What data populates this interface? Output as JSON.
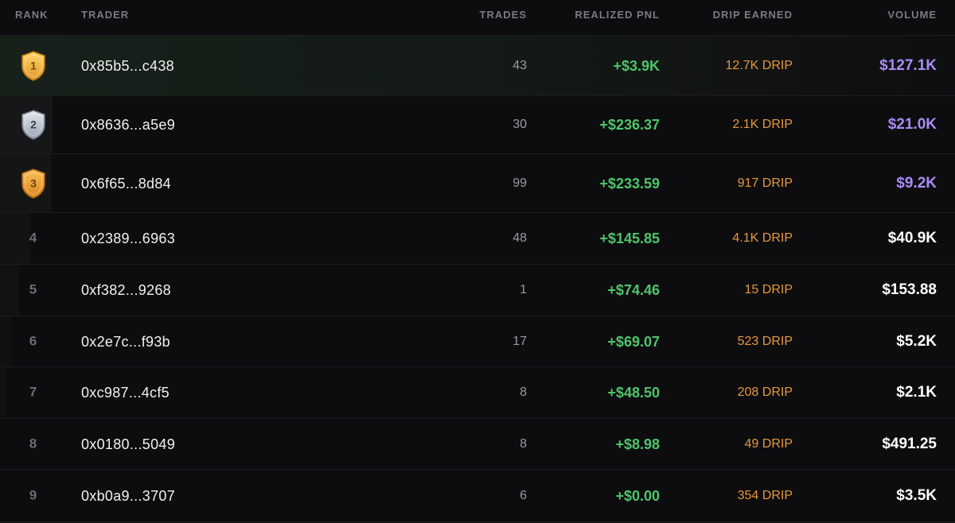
{
  "header": {
    "rank": "RANK",
    "trader": "TRADER",
    "trades": "TRADES",
    "pnl": "REALIZED PNL",
    "drip": "DRIP EARNED",
    "volume": "VOLUME"
  },
  "colors": {
    "gold": "#f3b63f",
    "silver": "#b9c0cc",
    "bronze": "#e2962f",
    "pnl_positive": "#4fc46a",
    "drip": "#e6983d",
    "volume_top": "#a98bf5",
    "volume": "#ffffff"
  },
  "rows": [
    {
      "rank": "1",
      "badge": "gold-shield-icon",
      "trader": "0x85b5...c438",
      "trades": "43",
      "pnl": "+$3.9K",
      "drip": "12.7K DRIP",
      "volume": "$127.1K"
    },
    {
      "rank": "2",
      "badge": "silver-shield-icon",
      "trader": "0x8636...a5e9",
      "trades": "30",
      "pnl": "+$236.37",
      "drip": "2.1K DRIP",
      "volume": "$21.0K"
    },
    {
      "rank": "3",
      "badge": "bronze-shield-icon",
      "trader": "0x6f65...8d84",
      "trades": "99",
      "pnl": "+$233.59",
      "drip": "917 DRIP",
      "volume": "$9.2K"
    },
    {
      "rank": "4",
      "trader": "0x2389...6963",
      "trades": "48",
      "pnl": "+$145.85",
      "drip": "4.1K DRIP",
      "volume": "$40.9K"
    },
    {
      "rank": "5",
      "trader": "0xf382...9268",
      "trades": "1",
      "pnl": "+$74.46",
      "drip": "15 DRIP",
      "volume": "$153.88"
    },
    {
      "rank": "6",
      "trader": "0x2e7c...f93b",
      "trades": "17",
      "pnl": "+$69.07",
      "drip": "523 DRIP",
      "volume": "$5.2K"
    },
    {
      "rank": "7",
      "trader": "0xc987...4cf5",
      "trades": "8",
      "pnl": "+$48.50",
      "drip": "208 DRIP",
      "volume": "$2.1K"
    },
    {
      "rank": "8",
      "trader": "0x0180...5049",
      "trades": "8",
      "pnl": "+$8.98",
      "drip": "49 DRIP",
      "volume": "$491.25"
    },
    {
      "rank": "9",
      "trader": "0xb0a9...3707",
      "trades": "6",
      "pnl": "+$0.00",
      "drip": "354 DRIP",
      "volume": "$3.5K"
    }
  ]
}
